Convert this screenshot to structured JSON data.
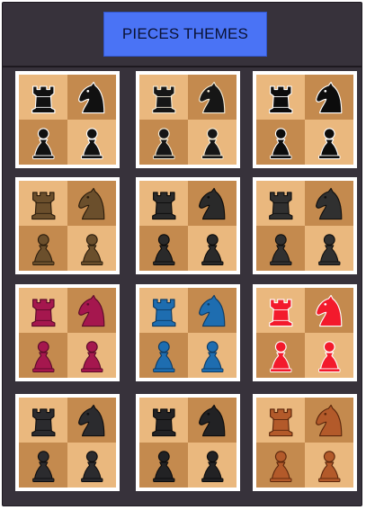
{
  "header": {
    "title": "PIECES THEMES"
  },
  "themes": [
    {
      "id": "theme-1",
      "fill": "#111111",
      "stroke": "#ffffff",
      "style": "flat"
    },
    {
      "id": "theme-2",
      "fill": "#161616",
      "stroke": "#f4ecd8",
      "style": "classic"
    },
    {
      "id": "theme-3",
      "fill": "#0c0c0c",
      "stroke": "#ffffff",
      "style": "bold"
    },
    {
      "id": "theme-4",
      "fill": "#6b4f2c",
      "stroke": "#2a1c0c",
      "style": "wood"
    },
    {
      "id": "theme-5",
      "fill": "#2a2a2a",
      "stroke": "#0a0a0a",
      "style": "metal"
    },
    {
      "id": "theme-6",
      "fill": "#303030",
      "stroke": "#0f0f0f",
      "style": "metal"
    },
    {
      "id": "theme-7",
      "fill": "#a5174e",
      "stroke": "#5a0a28",
      "style": "magenta"
    },
    {
      "id": "theme-8",
      "fill": "#1e6db0",
      "stroke": "#0c3a63",
      "style": "blue"
    },
    {
      "id": "theme-9",
      "fill": "#f31a2c",
      "stroke": "#ffffff",
      "style": "red"
    },
    {
      "id": "theme-10",
      "fill": "#2b2b2e",
      "stroke": "#0d0d0f",
      "style": "3d-dark"
    },
    {
      "id": "theme-11",
      "fill": "#222224",
      "stroke": "#0b0b0c",
      "style": "3d-dark"
    },
    {
      "id": "theme-12",
      "fill": "#b35a2a",
      "stroke": "#5a260c",
      "style": "3d-copper"
    }
  ],
  "pieces": [
    "rook-icon",
    "knight-icon",
    "pawn-icon",
    "pawn-icon"
  ]
}
